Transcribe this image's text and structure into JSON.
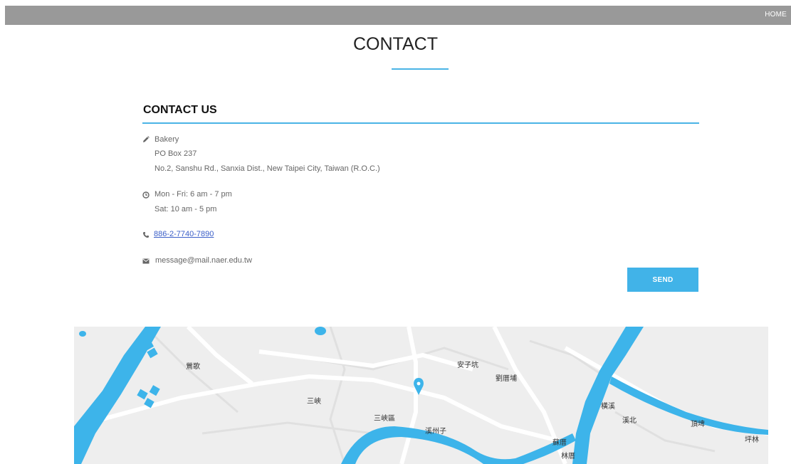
{
  "nav": {
    "home_label": "HOME"
  },
  "page": {
    "title": "CONTACT"
  },
  "contact": {
    "heading": "CONTACT US",
    "address": {
      "icon": "pencil-icon",
      "name": "Bakery",
      "po_box": "PO Box 237",
      "street": "No.2, Sanshu Rd., Sanxia Dist., New Taipei City, Taiwan (R.O.C.)"
    },
    "hours": {
      "icon": "clock-icon",
      "weekday": "Mon - Fri: 6 am - 7 pm",
      "saturday": "Sat: 10 am - 5 pm"
    },
    "phone": {
      "icon": "phone-icon",
      "number": "886-2-7740-7890"
    },
    "email": {
      "icon": "envelope-icon",
      "address": "message@mail.naer.edu.tw"
    },
    "send_label": "SEND"
  },
  "map": {
    "labels": {
      "yingge": "鶯歌",
      "sanxia": "三峽",
      "sanxia_dist": "三峽區",
      "xizhouzi": "溪州子",
      "anzikeng": "安子坑",
      "liuliaodi": "劉厝埔",
      "hengxi": "橫溪",
      "jiangbei": "溪北",
      "dingpi": "頂埤",
      "luzhu": "蘇厝",
      "linlan": "林厝",
      "pinglin": "坪林"
    },
    "colors": {
      "water": "#3db4ea",
      "land": "#eeeeee",
      "road": "#ffffff",
      "minor_road": "#e2e2e2"
    }
  },
  "colors": {
    "accent": "#4ab4e6",
    "topbar": "#999999"
  }
}
